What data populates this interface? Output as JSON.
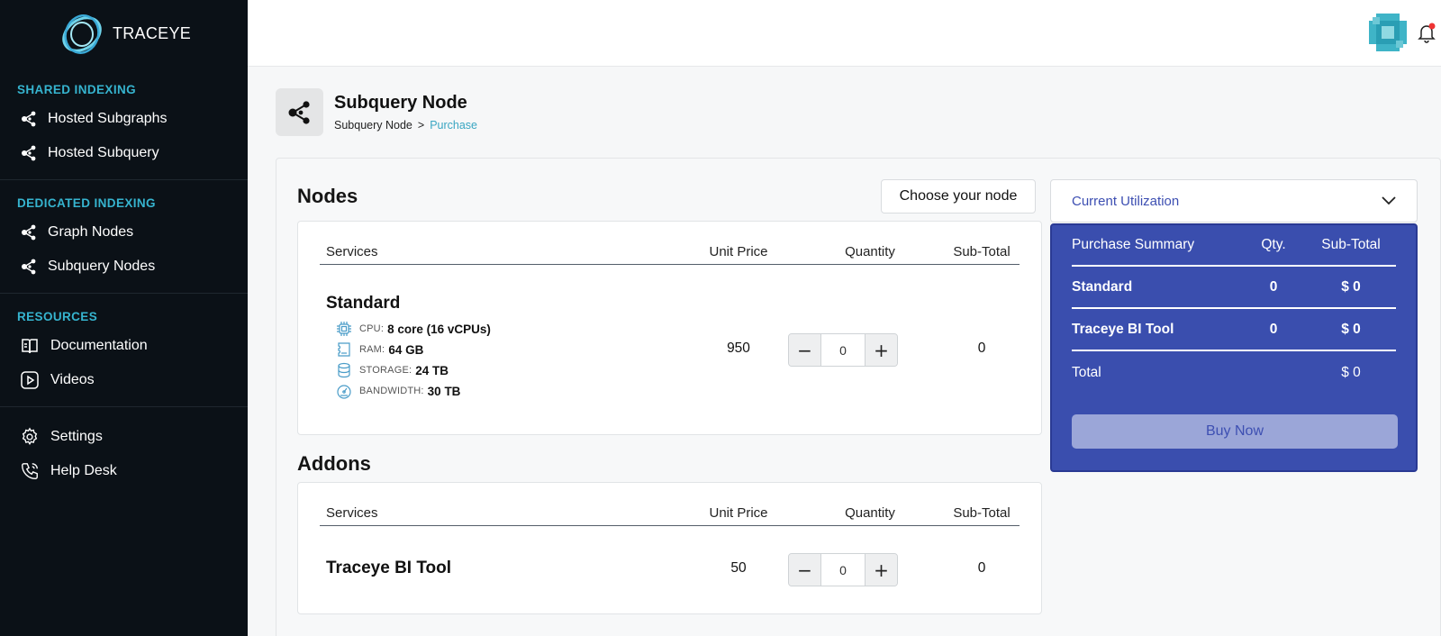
{
  "app": {
    "brand": "TRACEYE"
  },
  "sidebar": {
    "sections": [
      {
        "heading": "SHARED INDEXING",
        "items": [
          {
            "label": "Hosted Subgraphs",
            "icon": "nodes-icon"
          },
          {
            "label": "Hosted Subquery",
            "icon": "nodes-icon"
          }
        ]
      },
      {
        "heading": "DEDICATED INDEXING",
        "items": [
          {
            "label": "Graph Nodes",
            "icon": "nodes-icon"
          },
          {
            "label": "Subquery Nodes",
            "icon": "nodes-icon"
          }
        ]
      },
      {
        "heading": "RESOURCES",
        "items": [
          {
            "label": "Documentation",
            "icon": "book-icon"
          },
          {
            "label": "Videos",
            "icon": "play-icon"
          }
        ]
      }
    ],
    "footer_items": [
      {
        "label": "Settings",
        "icon": "gear-icon"
      },
      {
        "label": "Help Desk",
        "icon": "phone-icon"
      }
    ]
  },
  "header": {
    "title": "Subquery Node",
    "breadcrumb": {
      "parent": "Subquery Node",
      "separator": ">",
      "current": "Purchase"
    }
  },
  "nodes": {
    "title": "Nodes",
    "choose_label": "Choose your node",
    "columns": {
      "services": "Services",
      "unit_price": "Unit Price",
      "quantity": "Quantity",
      "subtotal": "Sub-Total"
    },
    "row": {
      "name": "Standard",
      "specs": [
        {
          "label": "CPU:",
          "value": "8 core (16 vCPUs)",
          "icon": "cpu-icon"
        },
        {
          "label": "RAM:",
          "value": "64 GB",
          "icon": "memory-icon"
        },
        {
          "label": "STORAGE:",
          "value": "24 TB",
          "icon": "database-icon"
        },
        {
          "label": "BANDWIDTH:",
          "value": "30 TB",
          "icon": "bandwidth-icon"
        }
      ],
      "unit_price": "950",
      "quantity": "0",
      "subtotal": "0"
    }
  },
  "addons": {
    "title": "Addons",
    "columns": {
      "services": "Services",
      "unit_price": "Unit Price",
      "quantity": "Quantity",
      "subtotal": "Sub-Total"
    },
    "row": {
      "name": "Traceye BI Tool",
      "unit_price": "50",
      "quantity": "0",
      "subtotal": "0"
    }
  },
  "stepper": {
    "minus": "−",
    "plus": "+"
  },
  "utilization": {
    "label": "Current Utilization"
  },
  "summary": {
    "heading": "Purchase Summary",
    "qty_header": "Qty.",
    "subtotal_header": "Sub-Total",
    "rows": [
      {
        "name": "Standard",
        "qty": "0",
        "subtotal": "$ 0"
      },
      {
        "name": "Traceye BI Tool",
        "qty": "0",
        "subtotal": "$ 0"
      }
    ],
    "total_label": "Total",
    "total_value": "$ 0",
    "buy_label": "Buy Now"
  },
  "colors": {
    "sidebar_bg": "#0b1117",
    "accent": "#36b4cf",
    "summary_bg": "#3a4eae",
    "buy_button": "#9ba6d8"
  }
}
